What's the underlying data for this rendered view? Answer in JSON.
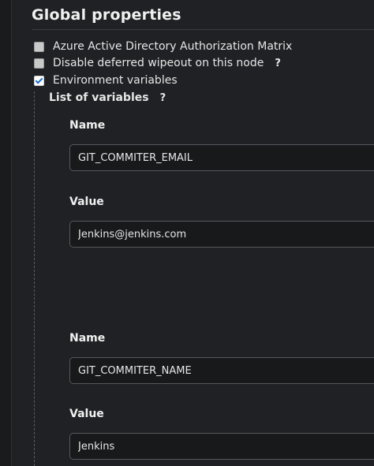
{
  "section": {
    "title": "Global properties"
  },
  "options": [
    {
      "label": "Azure Active Directory Authorization Matrix",
      "checked": false,
      "help": ""
    },
    {
      "label": "Disable deferred wipeout on this node",
      "checked": false,
      "help": "?"
    },
    {
      "label": "Environment variables",
      "checked": true,
      "help": ""
    }
  ],
  "env": {
    "list_label": "List of variables",
    "list_help": "?",
    "variables": [
      {
        "name_label": "Name",
        "name": "GIT_COMMITER_EMAIL",
        "value_label": "Value",
        "value": "Jenkins@jenkins.com"
      },
      {
        "name_label": "Name",
        "name": "GIT_COMMITER_NAME",
        "value_label": "Value",
        "value": "Jenkins"
      }
    ]
  }
}
